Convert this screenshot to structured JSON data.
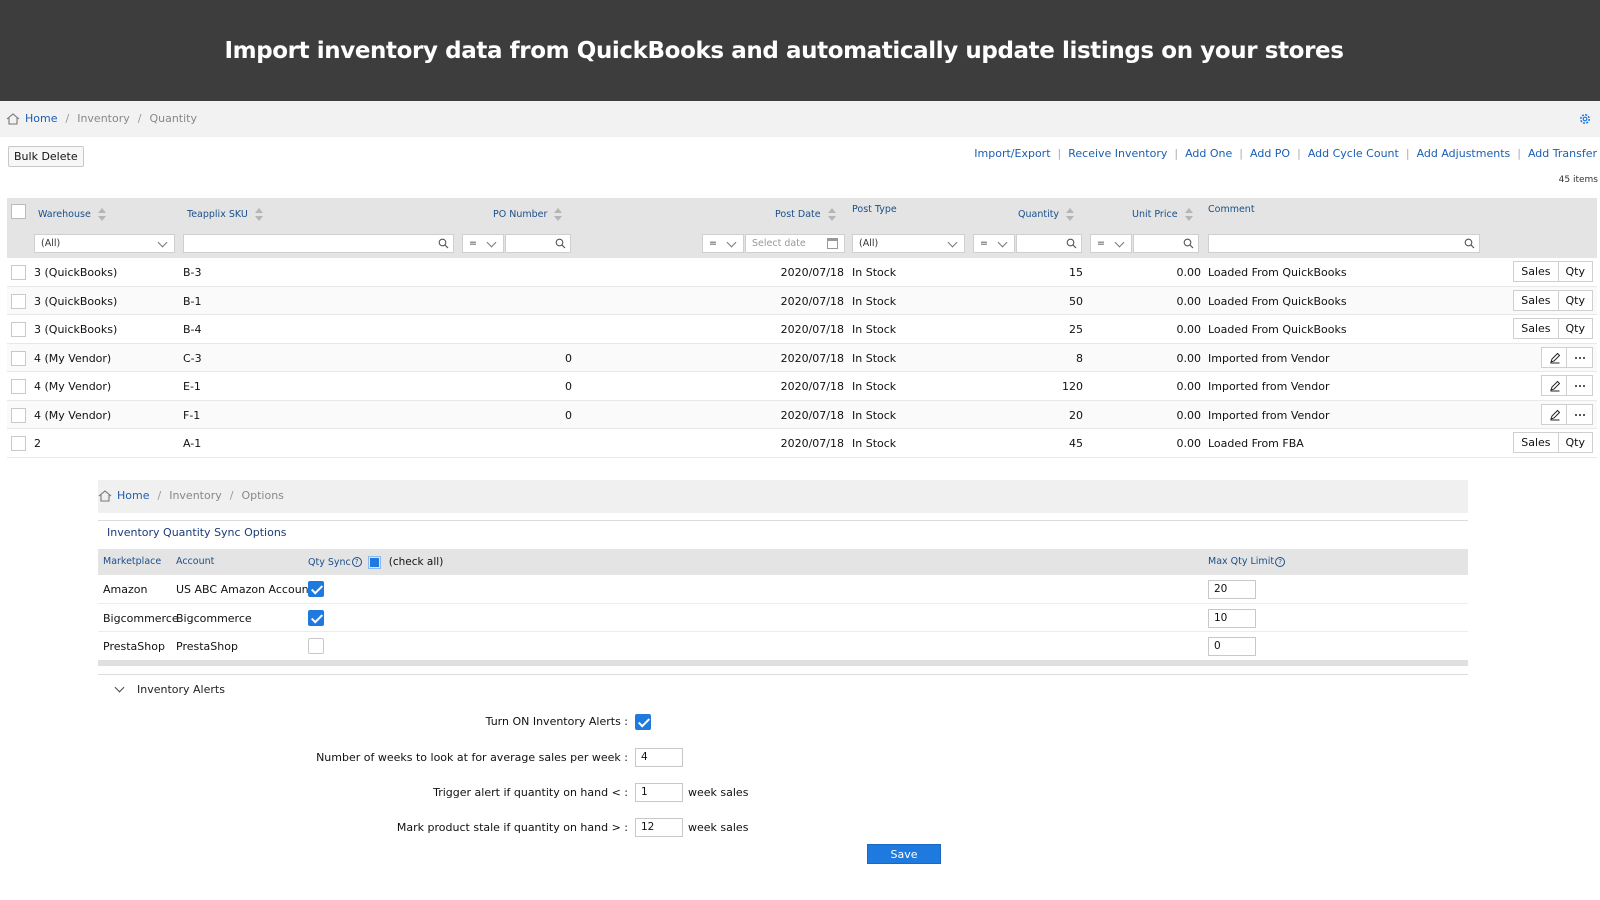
{
  "banner": {
    "title": "Import inventory data from QuickBooks and automatically update listings on your stores"
  },
  "breadcrumb": {
    "home": "Home",
    "level1": "Inventory",
    "level2": "Quantity"
  },
  "toolbar": {
    "bulk_delete": "Bulk Delete",
    "actions": [
      "Import/Export",
      "Receive Inventory",
      "Add One",
      "Add PO",
      "Add Cycle Count",
      "Add Adjustments",
      "Add Transfer"
    ],
    "items_count": "45 items"
  },
  "grid": {
    "columns": {
      "warehouse": "Warehouse",
      "sku": "Teapplix SKU",
      "po_number": "PO Number",
      "post_date": "Post Date",
      "post_type": "Post Type",
      "quantity": "Quantity",
      "unit_price": "Unit Price",
      "comment": "Comment"
    },
    "filters": {
      "warehouse": "(All)",
      "po_op": "=",
      "date_op": "=",
      "date_placeholder": "Select date",
      "post_type": "(All)",
      "qty_op": "=",
      "price_op": "="
    },
    "rows": [
      {
        "warehouse": "3 (QuickBooks)",
        "sku": "B-3",
        "po": "",
        "date": "2020/07/18",
        "type": "In Stock",
        "qty": "15",
        "price": "0.00",
        "comment": "Loaded From QuickBooks",
        "actions": "sales-qty"
      },
      {
        "warehouse": "3 (QuickBooks)",
        "sku": "B-1",
        "po": "",
        "date": "2020/07/18",
        "type": "In Stock",
        "qty": "50",
        "price": "0.00",
        "comment": "Loaded From QuickBooks",
        "actions": "sales-qty"
      },
      {
        "warehouse": "3 (QuickBooks)",
        "sku": "B-4",
        "po": "",
        "date": "2020/07/18",
        "type": "In Stock",
        "qty": "25",
        "price": "0.00",
        "comment": "Loaded From QuickBooks",
        "actions": "sales-qty"
      },
      {
        "warehouse": "4 (My Vendor)",
        "sku": "C-3",
        "po": "0",
        "date": "2020/07/18",
        "type": "In Stock",
        "qty": "8",
        "price": "0.00",
        "comment": "Imported from Vendor",
        "actions": "edit-more"
      },
      {
        "warehouse": "4 (My Vendor)",
        "sku": "E-1",
        "po": "0",
        "date": "2020/07/18",
        "type": "In Stock",
        "qty": "120",
        "price": "0.00",
        "comment": "Imported from Vendor",
        "actions": "edit-more"
      },
      {
        "warehouse": "4 (My Vendor)",
        "sku": "F-1",
        "po": "0",
        "date": "2020/07/18",
        "type": "In Stock",
        "qty": "20",
        "price": "0.00",
        "comment": "Imported from Vendor",
        "actions": "edit-more"
      },
      {
        "warehouse": "2",
        "sku": "A-1",
        "po": "",
        "date": "2020/07/18",
        "type": "In Stock",
        "qty": "45",
        "price": "0.00",
        "comment": "Loaded From FBA",
        "actions": "sales-qty"
      }
    ],
    "sales_label": "Sales",
    "qty_label": "Qty"
  },
  "options": {
    "breadcrumb": {
      "home": "Home",
      "level1": "Inventory",
      "level2": "Options"
    },
    "section_title": "Inventory Quantity Sync Options",
    "columns": {
      "marketplace": "Marketplace",
      "account": "Account",
      "qty_sync": "Qty Sync",
      "check_all": "(check all)",
      "max_qty": "Max Qty Limit"
    },
    "rows": [
      {
        "marketplace": "Amazon",
        "account": "US ABC Amazon Account",
        "sync": true,
        "max": "20"
      },
      {
        "marketplace": "Bigcommerce",
        "account": "Bigcommerce",
        "sync": true,
        "max": "10"
      },
      {
        "marketplace": "PrestaShop",
        "account": "PrestaShop",
        "sync": false,
        "max": "0"
      }
    ],
    "alerts": {
      "title": "Inventory Alerts",
      "turn_on_label": "Turn ON Inventory Alerts :",
      "turn_on": true,
      "weeks_label": "Number of weeks to look at for average sales per week :",
      "weeks_value": "4",
      "trigger_label": "Trigger alert if quantity on hand < :",
      "trigger_value": "1",
      "trigger_suffix": "week sales",
      "stale_label": "Mark product stale if quantity on hand > :",
      "stale_value": "12",
      "stale_suffix": "week sales"
    },
    "save_label": "Save"
  },
  "colors": {
    "banner_bg": "#3d3d3d",
    "link": "#1a5fb4",
    "accent": "#1f7ae0",
    "header_bg": "#e4e4e4"
  }
}
